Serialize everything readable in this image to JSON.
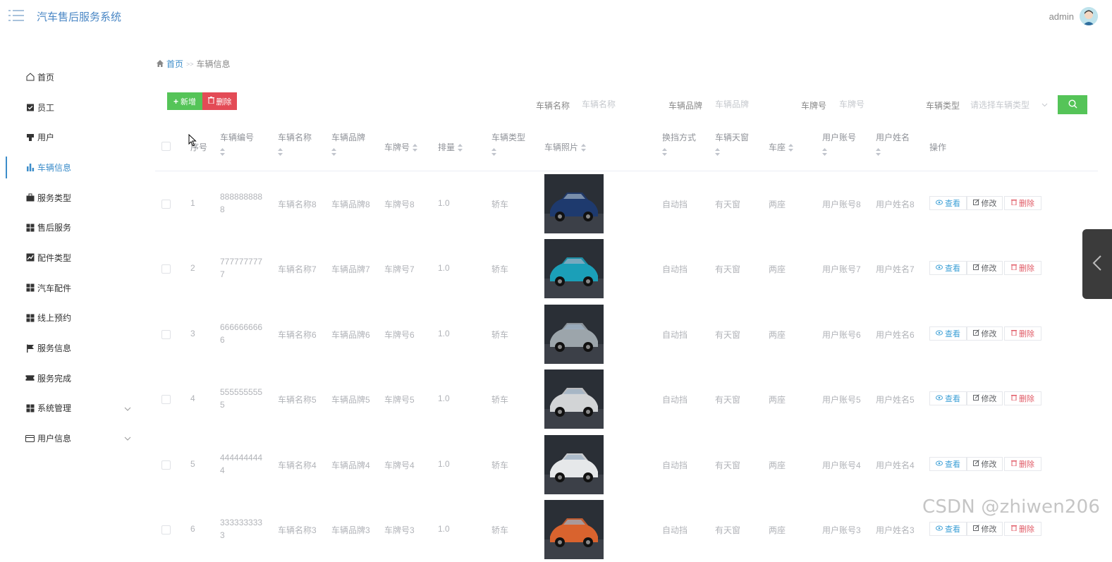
{
  "header": {
    "title": "汽车售后服务系统",
    "username": "admin"
  },
  "sidebar": {
    "items": [
      {
        "label": "首页",
        "icon": "home-icon"
      },
      {
        "label": "员工",
        "icon": "clipboard-check-icon"
      },
      {
        "label": "用户",
        "icon": "user-icon"
      },
      {
        "label": "车辆信息",
        "icon": "bar-chart-icon",
        "active": true
      },
      {
        "label": "服务类型",
        "icon": "briefcase-icon"
      },
      {
        "label": "售后服务",
        "icon": "grid-icon"
      },
      {
        "label": "配件类型",
        "icon": "line-chart-icon"
      },
      {
        "label": "汽车配件",
        "icon": "grid-icon"
      },
      {
        "label": "线上预约",
        "icon": "grid-icon"
      },
      {
        "label": "服务信息",
        "icon": "flag-icon"
      },
      {
        "label": "服务完成",
        "icon": "ticket-icon"
      },
      {
        "label": "系统管理",
        "icon": "grid-icon",
        "expandable": true
      },
      {
        "label": "用户信息",
        "icon": "card-icon",
        "expandable": true
      }
    ]
  },
  "breadcrumb": {
    "home": "首页",
    "separator": ">>",
    "current": "车辆信息"
  },
  "toolbar": {
    "add_label": "新增",
    "delete_label": "删除"
  },
  "filters": {
    "name_label": "车辆名称",
    "name_placeholder": "车辆名称",
    "brand_label": "车辆品牌",
    "brand_placeholder": "车辆品牌",
    "plate_label": "车牌号",
    "plate_placeholder": "车牌号",
    "type_label": "车辆类型",
    "type_placeholder": "请选择车辆类型"
  },
  "table": {
    "headers": {
      "index": "序号",
      "code": "车辆编号",
      "name": "车辆名称",
      "brand": "车辆品牌",
      "plate": "车牌号",
      "displacement": "排量",
      "type": "车辆类型",
      "photo": "车辆照片",
      "gear": "换挡方式",
      "sunroof": "车辆天窗",
      "seats": "车座",
      "user_account": "用户账号",
      "user_name": "用户姓名",
      "actions": "操作"
    },
    "actions": {
      "view": "查看",
      "edit": "修改",
      "delete": "删除"
    },
    "rows": [
      {
        "index": "1",
        "code": "8888888888",
        "name": "车辆名称8",
        "brand": "车辆品牌8",
        "plate": "车牌号8",
        "displacement": "1.0",
        "type": "轿车",
        "photo_color": "#1e3a6e",
        "gear": "自动挡",
        "sunroof": "有天窗",
        "seats": "两座",
        "user_account": "用户账号8",
        "user_name": "用户姓名8"
      },
      {
        "index": "2",
        "code": "7777777777",
        "name": "车辆名称7",
        "brand": "车辆品牌7",
        "plate": "车牌号7",
        "displacement": "1.0",
        "type": "轿车",
        "photo_color": "#1b9fb8",
        "gear": "自动挡",
        "sunroof": "有天窗",
        "seats": "两座",
        "user_account": "用户账号7",
        "user_name": "用户姓名7"
      },
      {
        "index": "3",
        "code": "6666666666",
        "name": "车辆名称6",
        "brand": "车辆品牌6",
        "plate": "车牌号6",
        "displacement": "1.0",
        "type": "轿车",
        "photo_color": "#9ca5ab",
        "gear": "自动挡",
        "sunroof": "有天窗",
        "seats": "两座",
        "user_account": "用户账号6",
        "user_name": "用户姓名6"
      },
      {
        "index": "4",
        "code": "5555555555",
        "name": "车辆名称5",
        "brand": "车辆品牌5",
        "plate": "车牌号5",
        "displacement": "1.0",
        "type": "轿车",
        "photo_color": "#d2d4d6",
        "gear": "自动挡",
        "sunroof": "有天窗",
        "seats": "两座",
        "user_account": "用户账号5",
        "user_name": "用户姓名5"
      },
      {
        "index": "5",
        "code": "4444444444",
        "name": "车辆名称4",
        "brand": "车辆品牌4",
        "plate": "车牌号4",
        "displacement": "1.0",
        "type": "轿车",
        "photo_color": "#e6e8ea",
        "gear": "自动挡",
        "sunroof": "有天窗",
        "seats": "两座",
        "user_account": "用户账号4",
        "user_name": "用户姓名4"
      },
      {
        "index": "6",
        "code": "3333333333",
        "name": "车辆名称3",
        "brand": "车辆品牌3",
        "plate": "车牌号3",
        "displacement": "1.0",
        "type": "轿车",
        "photo_color": "#d9632e",
        "gear": "自动挡",
        "sunroof": "有天窗",
        "seats": "两座",
        "user_account": "用户账号3",
        "user_name": "用户姓名3"
      }
    ]
  },
  "watermark": "CSDN @zhiwen206"
}
